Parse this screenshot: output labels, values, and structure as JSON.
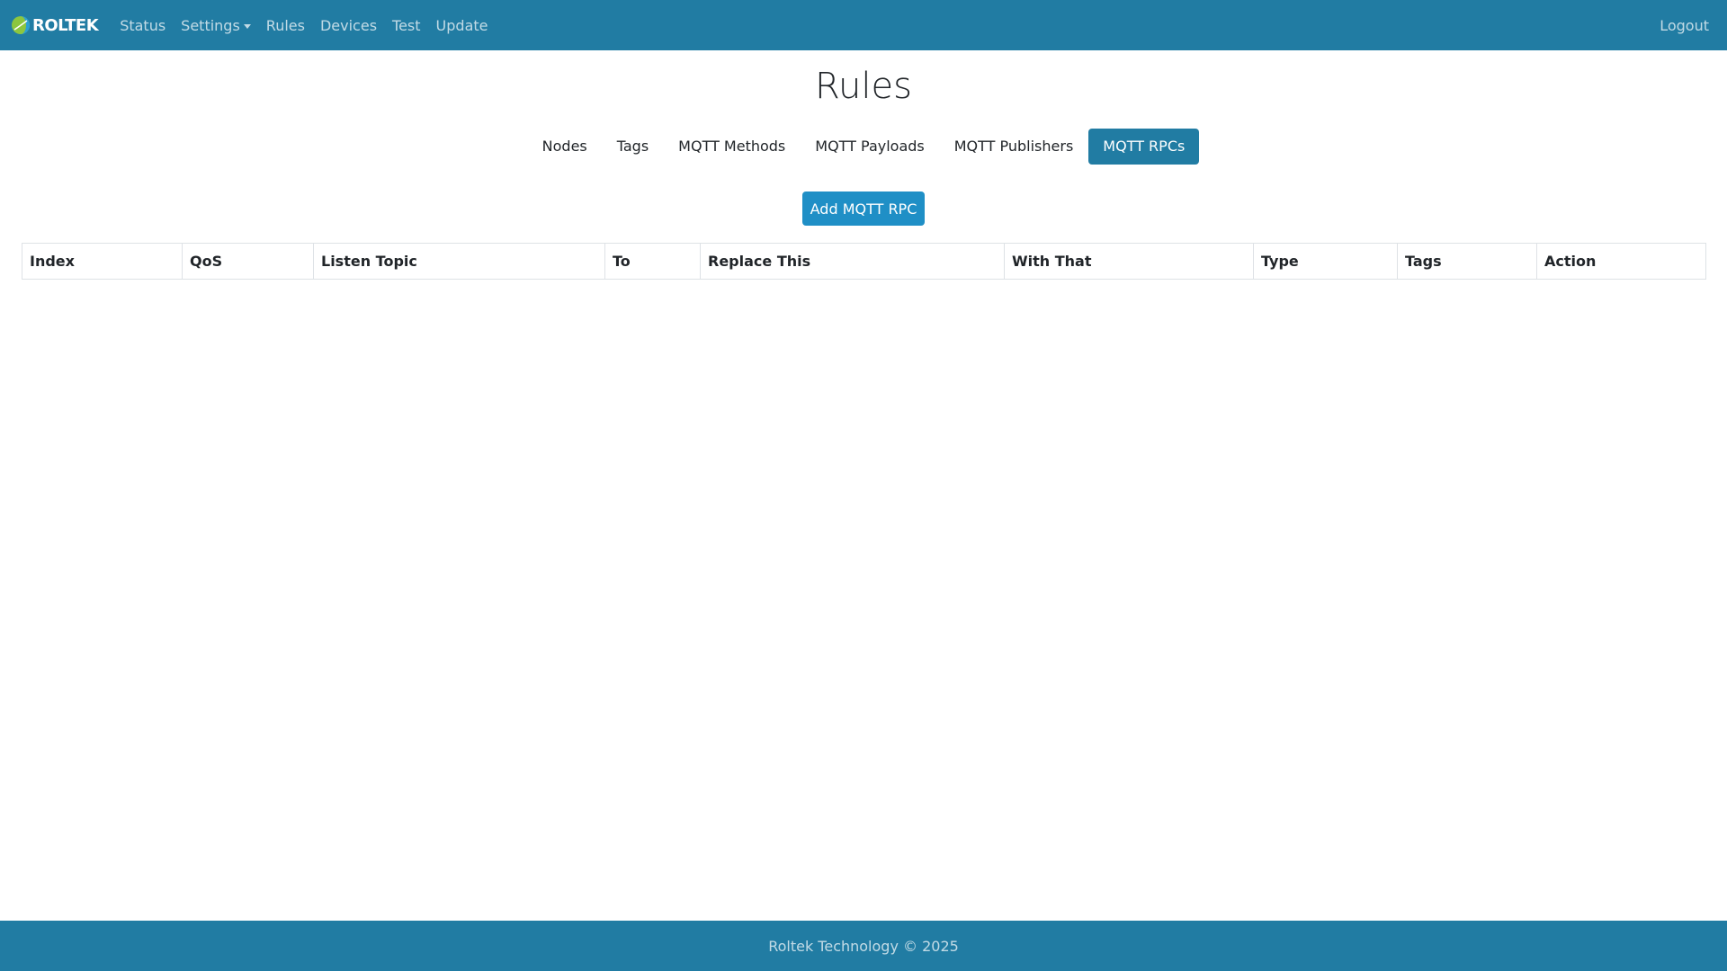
{
  "navbar": {
    "brand": "ROLTEK",
    "links": [
      {
        "label": "Status"
      },
      {
        "label": "Settings"
      },
      {
        "label": "Rules"
      },
      {
        "label": "Devices"
      },
      {
        "label": "Test"
      },
      {
        "label": "Update"
      }
    ],
    "logout": "Logout",
    "color": "#217ca3"
  },
  "page": {
    "title": "Rules"
  },
  "tabs": [
    {
      "label": "Nodes",
      "active": false
    },
    {
      "label": "Tags",
      "active": false
    },
    {
      "label": "MQTT Methods",
      "active": false
    },
    {
      "label": "MQTT Payloads",
      "active": false
    },
    {
      "label": "MQTT Publishers",
      "active": false
    },
    {
      "label": "MQTT RPCs",
      "active": true
    }
  ],
  "actions": {
    "add_label": "Add MQTT RPC"
  },
  "table": {
    "columns": [
      "Index",
      "QoS",
      "Listen Topic",
      "To",
      "Replace This",
      "With That",
      "Type",
      "Tags",
      "Action"
    ],
    "rows": []
  },
  "footer": {
    "text": "Roltek Technology © 2025"
  }
}
